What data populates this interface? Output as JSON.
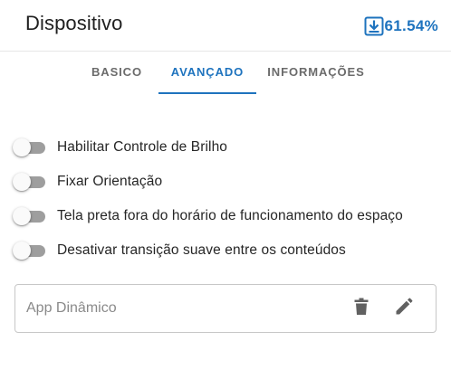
{
  "header": {
    "title": "Dispositivo",
    "download_percent": "61.54%",
    "download_icon": "download-box-icon",
    "accent_color": "#1e73be"
  },
  "tabs": [
    {
      "label": "BASICO",
      "active": false
    },
    {
      "label": "AVANÇADO",
      "active": true
    },
    {
      "label": "INFORMAÇÕES",
      "active": false
    }
  ],
  "toggles": [
    {
      "label": "Habilitar Controle de Brilho",
      "checked": false
    },
    {
      "label": "Fixar Orientação",
      "checked": false
    },
    {
      "label": "Tela preta fora do horário de funcionamento do espaço",
      "checked": false
    },
    {
      "label": "Desativar transição suave entre os conteúdos",
      "checked": false
    }
  ],
  "app_field": {
    "placeholder": "App Dinâmico",
    "value": "",
    "delete_icon": "trash-icon",
    "edit_icon": "pencil-icon"
  }
}
